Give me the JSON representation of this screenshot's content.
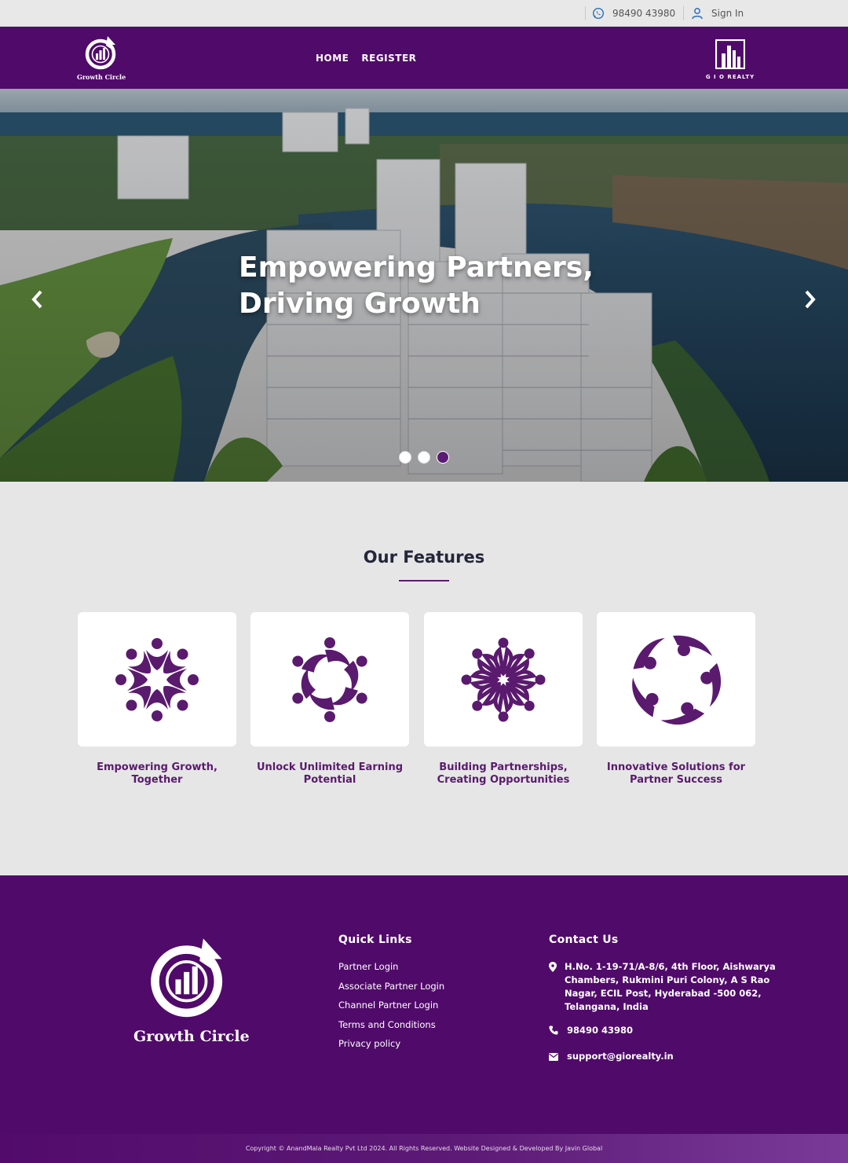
{
  "topbar": {
    "phone": "98490 43980",
    "signin": "Sign In"
  },
  "nav": {
    "brand_caption": "Growth Circle",
    "links": [
      "HOME",
      "REGISTER"
    ],
    "partner_caption": "G I O REALTY"
  },
  "hero": {
    "headline_line1": "Empowering Partners,",
    "headline_line2": "Driving Growth",
    "slides": 3,
    "active_slide": 3
  },
  "features": {
    "title": "Our Features",
    "items": [
      {
        "label_line1": "Empowering Growth,",
        "label_line2": "Together",
        "icon": "people-circle-icon"
      },
      {
        "label_line1": "Unlock Unlimited Earning",
        "label_line2": "Potential",
        "icon": "people-swirl-icon"
      },
      {
        "label_line1": "Building Partnerships,",
        "label_line2": "Creating Opportunities",
        "icon": "people-star-icon"
      },
      {
        "label_line1": "Innovative Solutions for",
        "label_line2": "Partner Success",
        "icon": "people-ring-icon"
      }
    ]
  },
  "footer": {
    "brand_caption": "Growth Circle",
    "quick_links_title": "Quick Links",
    "quick_links": [
      "Partner Login",
      "Associate Partner Login",
      "Channel Partner Login",
      "Terms and Conditions",
      "Privacy policy"
    ],
    "contact_title": "Contact Us",
    "address_lines": [
      "H.No. 1-19-71/A-8/6, 4th Floor, Aishwarya",
      "Chambers, Rukmini Puri Colony, A S Rao",
      "Nagar, ECIL Post, Hyderabad -500 062,",
      "Telangana, India"
    ],
    "phone": "98490 43980",
    "email": "support@giorealty.in",
    "copyright": "Copyright © AnandMala Realty Pvt Ltd 2024. All Rights Reserved. Website Designed & Developed By Javin Global"
  },
  "colors": {
    "brand_purple": "#500a6a",
    "feature_purple": "#5a1a6e",
    "page_bg": "#e6e6e6"
  }
}
